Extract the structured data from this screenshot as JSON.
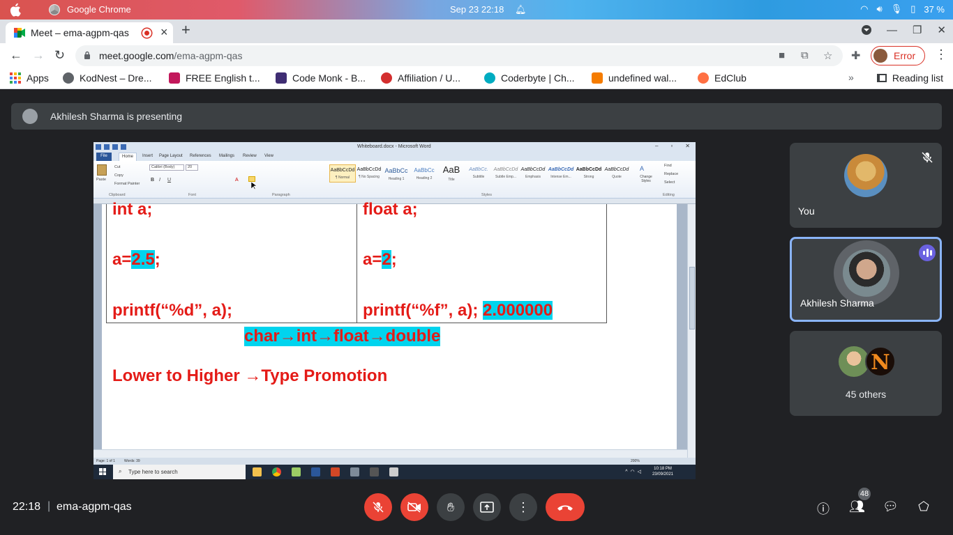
{
  "os": {
    "app_name": "Google Chrome",
    "datetime": "Sep 23  22:18",
    "battery": "37 %"
  },
  "browser": {
    "tab_title": "Meet – ema-agpm-qas",
    "url_domain": "meet.google.com",
    "url_path": "/ema-agpm-qas",
    "profile_status": "Error",
    "bookmarks": [
      {
        "label": "Apps",
        "color": "#ea4335"
      },
      {
        "label": "KodNest – Dre...",
        "color": "#5f6368"
      },
      {
        "label": "FREE English t...",
        "color": "#c2185b"
      },
      {
        "label": "Code Monk - B...",
        "color": "#3f2d73"
      },
      {
        "label": "Affiliation / U...",
        "color": "#d32f2f"
      },
      {
        "label": "Coderbyte | Ch...",
        "color": "#00acc1"
      },
      {
        "label": "undefined wal...",
        "color": "#f57c00"
      },
      {
        "label": "EdClub",
        "color": "#ff7043"
      }
    ],
    "reading_list": "Reading list"
  },
  "meet": {
    "presenting_text": "Akhilesh Sharma is presenting",
    "participants": [
      {
        "name": "You"
      },
      {
        "name": "Akhilesh Sharma"
      }
    ],
    "others_label": "45 others",
    "others_initial": "N",
    "time": "22:18",
    "separator": "|",
    "meeting_code": "ema-agpm-qas",
    "people_count": "48",
    "accent_color": "#8ab4f8",
    "danger_color": "#ea4335"
  },
  "word": {
    "window_title": "Whiteboard.docx - Microsoft Word",
    "tabs": [
      "File",
      "Home",
      "Insert",
      "Page Layout",
      "References",
      "Mailings",
      "Review",
      "View"
    ],
    "font_name": "Calibri (Body)",
    "font_size": "20",
    "clipboard": {
      "paste": "Paste",
      "cut": "Cut",
      "copy": "Copy",
      "format_painter": "Format Painter"
    },
    "groups": [
      "Clipboard",
      "Font",
      "Paragraph",
      "Styles",
      "Editing"
    ],
    "styles": [
      {
        "sample": "AaBbCcDd",
        "name": "¶ Normal"
      },
      {
        "sample": "AaBbCcDd",
        "name": "¶ No Spacing"
      },
      {
        "sample": "AaBbCc",
        "name": "Heading 1"
      },
      {
        "sample": "AaBbCc",
        "name": "Heading 2"
      },
      {
        "sample": "AaB",
        "name": "Title"
      },
      {
        "sample": "AaBbCc.",
        "name": "Subtitle"
      },
      {
        "sample": "AaBbCcDd",
        "name": "Subtle Emp..."
      },
      {
        "sample": "AaBbCcDd",
        "name": "Emphasis"
      },
      {
        "sample": "AaBbCcDd",
        "name": "Intense Em..."
      },
      {
        "sample": "AaBbCcDd",
        "name": "Strong"
      },
      {
        "sample": "AaBbCcDd",
        "name": "Quote"
      }
    ],
    "change_styles": "Change Styles",
    "editing": {
      "find": "Find",
      "replace": "Replace",
      "select": "Select"
    },
    "doc": {
      "left_decl": "int a;",
      "left_assign_prefix": "a=",
      "left_assign_value": "2.5",
      "left_assign_suffix": ";",
      "left_printf": "printf(“%d”, a);",
      "right_decl": "float a;",
      "right_assign_prefix": "a=",
      "right_assign_value": "2",
      "right_assign_suffix": ";",
      "right_printf": "printf(“%f”, a); ",
      "right_output": "2.000000",
      "promotion_chain": "char→int→float→double",
      "promotion_rule": "Lower to Higher →Type Promotion",
      "text_color": "#e41b17",
      "highlight_color": "#00d4ee"
    },
    "status": {
      "page": "Page: 1 of 1",
      "words": "Words: 39",
      "zoom": "200%"
    },
    "taskbar": {
      "search_placeholder": "Type here to search",
      "clock_time": "10:18 PM",
      "clock_date": "23/09/2021"
    }
  }
}
